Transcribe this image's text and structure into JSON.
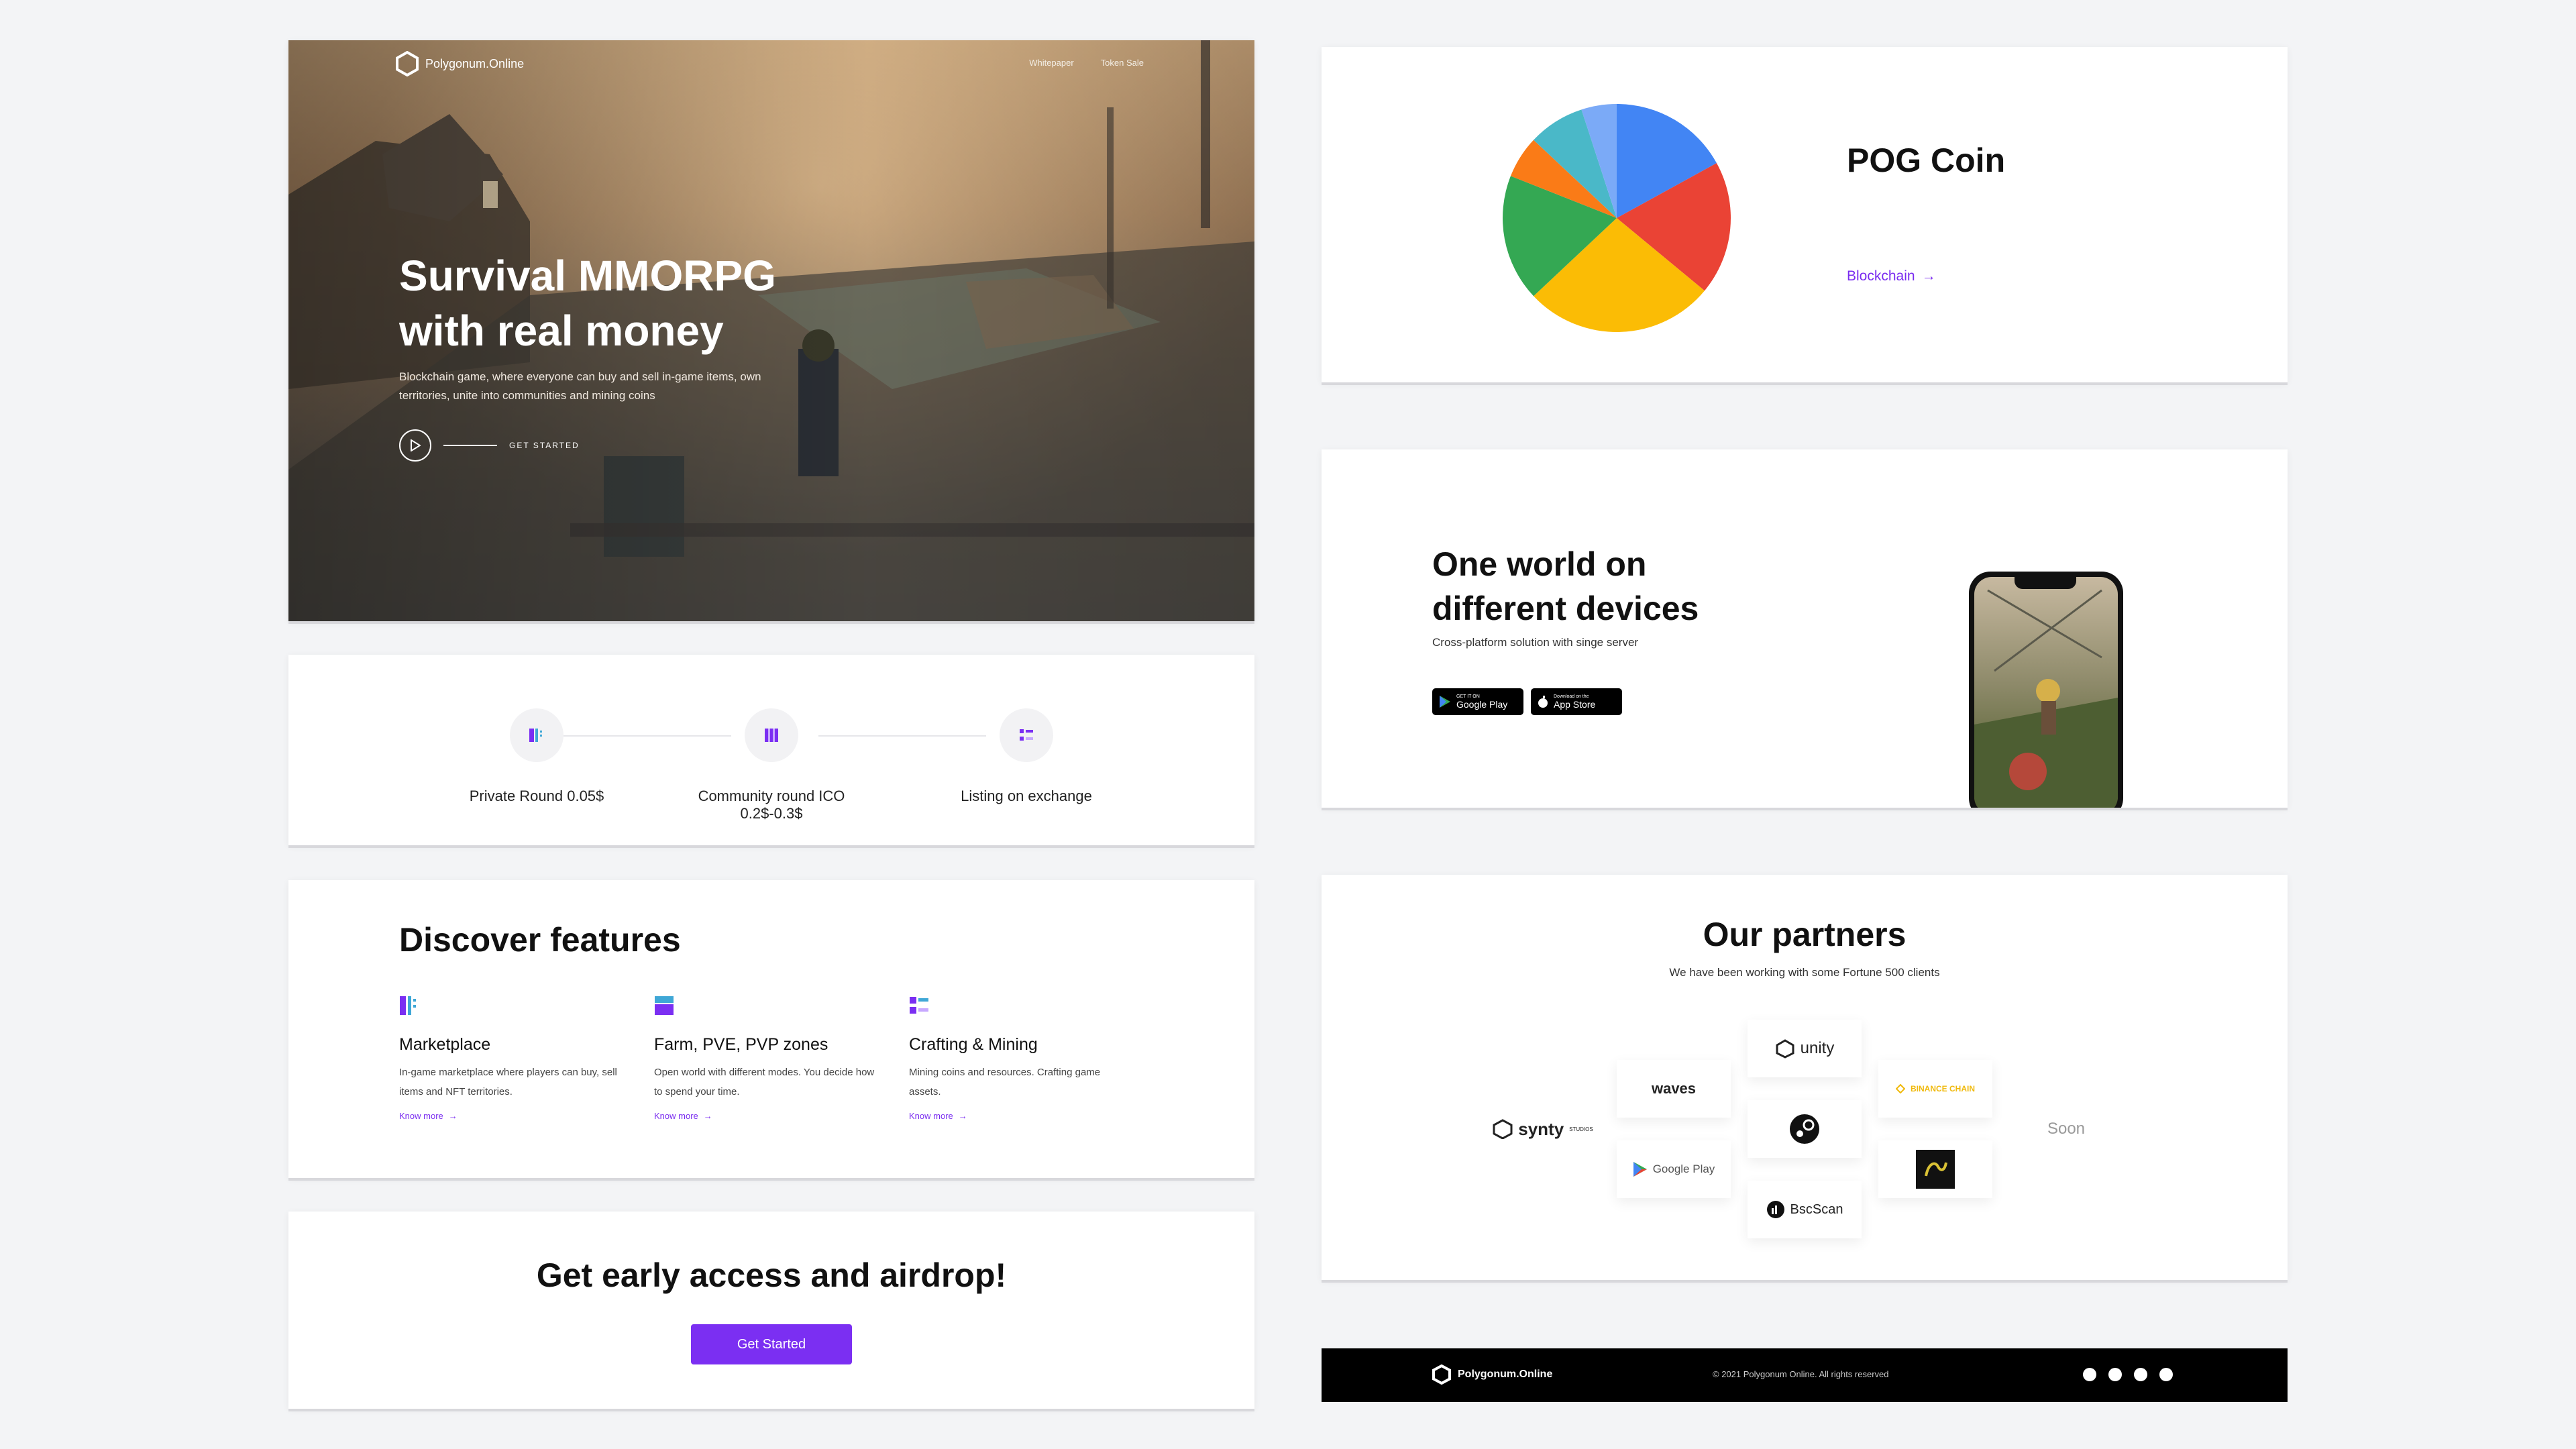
{
  "hero": {
    "brand": "Polygonum.Online",
    "nav": [
      "Whitepaper",
      "Token Sale"
    ],
    "title": "Survival MMORPG with real money",
    "subtitle": "Blockchain game, where everyone can buy and sell in-game items, own territories, unite into communities and mining coins",
    "cta": "GET STARTED"
  },
  "roadmap": {
    "steps": [
      "Private Round 0.05$",
      "Community round ICO 0.2$-0.3$",
      "Listing on exchange"
    ]
  },
  "features": {
    "title": "Discover features",
    "items": [
      {
        "title": "Marketplace",
        "desc": "In-game marketplace where players can buy, sell items and NFT territories.",
        "link": "Know more"
      },
      {
        "title": "Farm, PVE, PVP zones",
        "desc": "Open world with different modes. You decide how to spend your time.",
        "link": "Know more"
      },
      {
        "title": "Crafting & Mining",
        "desc": "Mining coins and resources. Crafting game assets.",
        "link": "Know more"
      }
    ]
  },
  "cta": {
    "title": "Get early access and airdrop!",
    "button": "Get Started"
  },
  "coin": {
    "title": "POG Coin",
    "link": "Blockchain"
  },
  "devices": {
    "title": "One world on different devices",
    "subtitle": "Cross-platform solution with singe server",
    "google": {
      "small": "GET IT ON",
      "big": "Google Play"
    },
    "apple": {
      "small": "Download on the",
      "big": "App Store"
    }
  },
  "partners": {
    "title": "Our partners",
    "subtitle": "We have been working with some Fortune 500 clients",
    "logos": {
      "synty": "synty",
      "synty_sub": "STUDIOS",
      "waves": "waves",
      "google": "Google Play",
      "unity": "unity",
      "bscscan": "BscScan",
      "binance": "BINANCE CHAIN",
      "soon": "Soon"
    }
  },
  "footer": {
    "brand": "Polygonum.Online",
    "copyright": "© 2021 Polygonum Online. All rights reserved"
  },
  "colors": {
    "accent": "#7b2ff2",
    "pie": [
      "#4285f4",
      "#ea4335",
      "#fbbc05",
      "#34a853",
      "#fa7b17",
      "#4ab8c8",
      "#7baaf7"
    ]
  }
}
